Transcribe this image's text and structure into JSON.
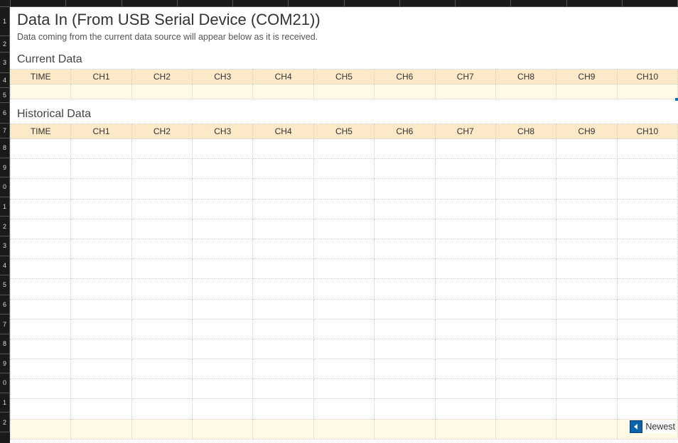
{
  "column_letters": [
    "",
    "",
    "",
    "",
    "",
    "",
    "",
    "",
    "",
    "",
    "",
    ""
  ],
  "row_numbers": [
    "1",
    "2",
    "3",
    "4",
    "5",
    "6",
    "7",
    "8",
    "9",
    "0",
    "1",
    "2",
    "3",
    "4",
    "5",
    "6",
    "7",
    "8",
    "9",
    "0",
    "1",
    "2"
  ],
  "title": "Data In (From USB Serial Device (COM21))",
  "subtitle": "Data coming from the current data source will appear below as it is received.",
  "sections": {
    "current": {
      "heading": "Current Data",
      "headers": [
        "TIME",
        "CH1",
        "CH2",
        "CH3",
        "CH4",
        "CH5",
        "CH6",
        "CH7",
        "CH8",
        "CH9",
        "CH10"
      ],
      "row": [
        "",
        "",
        "",
        "",
        "",
        "",
        "",
        "",
        "",
        "",
        ""
      ]
    },
    "historical": {
      "heading": "Historical Data",
      "headers": [
        "TIME",
        "CH1",
        "CH2",
        "CH3",
        "CH4",
        "CH5",
        "CH6",
        "CH7",
        "CH8",
        "CH9",
        "CH10"
      ],
      "row_count": 15
    }
  },
  "newest_label": "Newest"
}
